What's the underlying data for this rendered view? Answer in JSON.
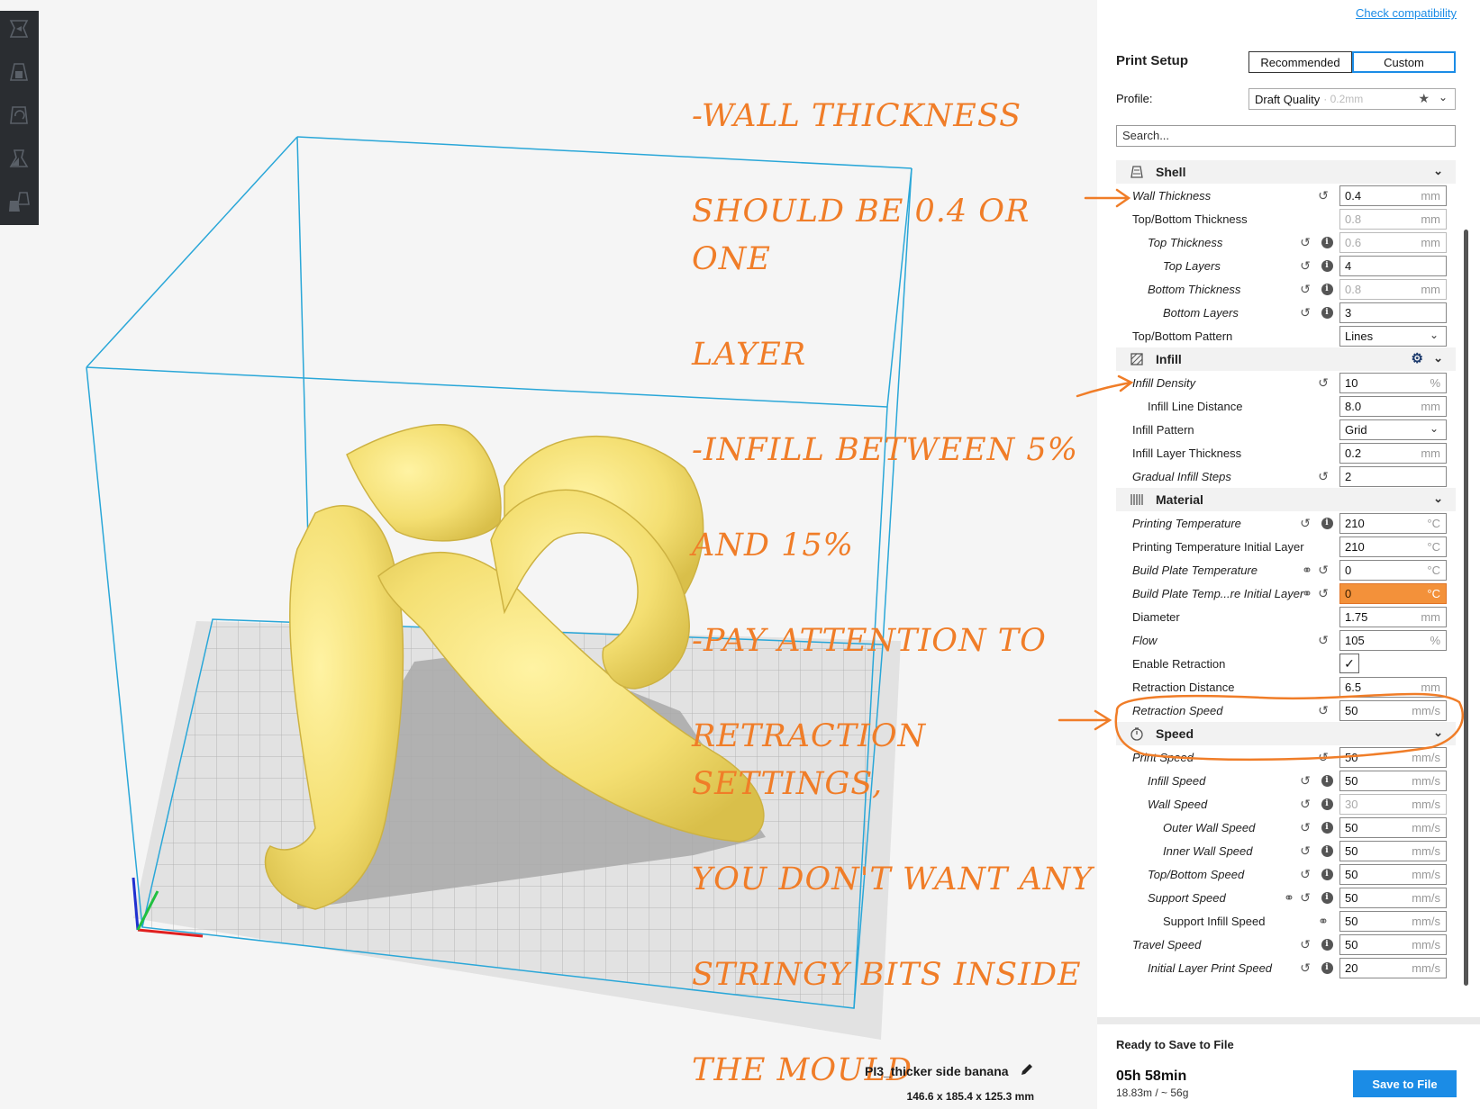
{
  "toolbar": {
    "tools": [
      {
        "icon": "move-icon"
      },
      {
        "icon": "scale-icon"
      },
      {
        "icon": "rotate-icon"
      },
      {
        "icon": "mirror-icon"
      },
      {
        "icon": "per-model-settings-icon"
      }
    ]
  },
  "annotation": {
    "lines": [
      "-WALL THICKNESS",
      "SHOULD BE 0.4 OR ONE",
      "LAYER",
      "-INFILL BETWEEN 5%",
      "AND 15%",
      "-PAY ATTENTION TO",
      "RETRACTION SETTINGS,",
      "YOU DON'T WANT ANY",
      "STRINGY BITS INSIDE",
      "THE MOULD"
    ],
    "color": "#f07d28"
  },
  "model": {
    "name": "PI3_thicker side banana",
    "dims": "146.6 x 185.4 x 125.3 mm",
    "color": "#f7e27a"
  },
  "panel": {
    "check_compat": "Check compatibility",
    "print_setup": "Print Setup",
    "tab_recommended": "Recommended",
    "tab_custom": "Custom",
    "profile_label": "Profile:",
    "profile_value": "Draft Quality",
    "profile_sub": "· 0.2mm",
    "search_value": "Search..."
  },
  "categories": {
    "shell": "Shell",
    "infill": "Infill",
    "material": "Material",
    "speed": "Speed"
  },
  "settings": {
    "wall_thickness": {
      "label": "Wall Thickness",
      "value": "0.4",
      "unit": "mm"
    },
    "top_bottom_thickness": {
      "label": "Top/Bottom Thickness",
      "value": "0.8",
      "unit": "mm"
    },
    "top_thickness": {
      "label": "Top Thickness",
      "value": "0.6",
      "unit": "mm"
    },
    "top_layers": {
      "label": "Top Layers",
      "value": "4"
    },
    "bottom_thickness": {
      "label": "Bottom Thickness",
      "value": "0.8",
      "unit": "mm"
    },
    "bottom_layers": {
      "label": "Bottom Layers",
      "value": "3"
    },
    "top_bottom_pattern": {
      "label": "Top/Bottom Pattern",
      "value": "Lines"
    },
    "infill_density": {
      "label": "Infill Density",
      "value": "10",
      "unit": "%"
    },
    "infill_line_distance": {
      "label": "Infill Line Distance",
      "value": "8.0",
      "unit": "mm"
    },
    "infill_pattern": {
      "label": "Infill Pattern",
      "value": "Grid"
    },
    "infill_layer_thickness": {
      "label": "Infill Layer Thickness",
      "value": "0.2",
      "unit": "mm"
    },
    "gradual_infill_steps": {
      "label": "Gradual Infill Steps",
      "value": "2"
    },
    "printing_temperature": {
      "label": "Printing Temperature",
      "value": "210",
      "unit": "°C"
    },
    "printing_temperature_initial": {
      "label": "Printing Temperature Initial Layer",
      "value": "210",
      "unit": "°C"
    },
    "build_plate_temperature": {
      "label": "Build Plate Temperature",
      "value": "0",
      "unit": "°C"
    },
    "build_plate_temperature_initial": {
      "label": "Build Plate Temp...re Initial Layer",
      "value": "0",
      "unit": "°C"
    },
    "diameter": {
      "label": "Diameter",
      "value": "1.75",
      "unit": "mm"
    },
    "flow": {
      "label": "Flow",
      "value": "105",
      "unit": "%"
    },
    "enable_retraction": {
      "label": "Enable Retraction",
      "value": "✓"
    },
    "retraction_distance": {
      "label": "Retraction Distance",
      "value": "6.5",
      "unit": "mm"
    },
    "retraction_speed": {
      "label": "Retraction Speed",
      "value": "50",
      "unit": "mm/s"
    },
    "print_speed": {
      "label": "Print Speed",
      "value": "50",
      "unit": "mm/s"
    },
    "infill_speed": {
      "label": "Infill Speed",
      "value": "50",
      "unit": "mm/s"
    },
    "wall_speed": {
      "label": "Wall Speed",
      "value": "30",
      "unit": "mm/s"
    },
    "outer_wall_speed": {
      "label": "Outer Wall Speed",
      "value": "50",
      "unit": "mm/s"
    },
    "inner_wall_speed": {
      "label": "Inner Wall Speed",
      "value": "50",
      "unit": "mm/s"
    },
    "top_bottom_speed": {
      "label": "Top/Bottom Speed",
      "value": "50",
      "unit": "mm/s"
    },
    "support_speed": {
      "label": "Support Speed",
      "value": "50",
      "unit": "mm/s"
    },
    "support_infill_speed": {
      "label": "Support Infill Speed",
      "value": "50",
      "unit": "mm/s"
    },
    "travel_speed": {
      "label": "Travel Speed",
      "value": "50",
      "unit": "mm/s"
    },
    "initial_layer_print_speed": {
      "label": "Initial Layer Print Speed",
      "value": "20",
      "unit": "mm/s"
    }
  },
  "footer": {
    "ready": "Ready to Save to File",
    "time": "05h 58min",
    "material": "18.83m / ~ 56g",
    "save_button": "Save to File"
  },
  "colors": {
    "accent": "#1b8ce6",
    "error_field": "#f3913a",
    "build_volume": "#2aa7d8"
  }
}
